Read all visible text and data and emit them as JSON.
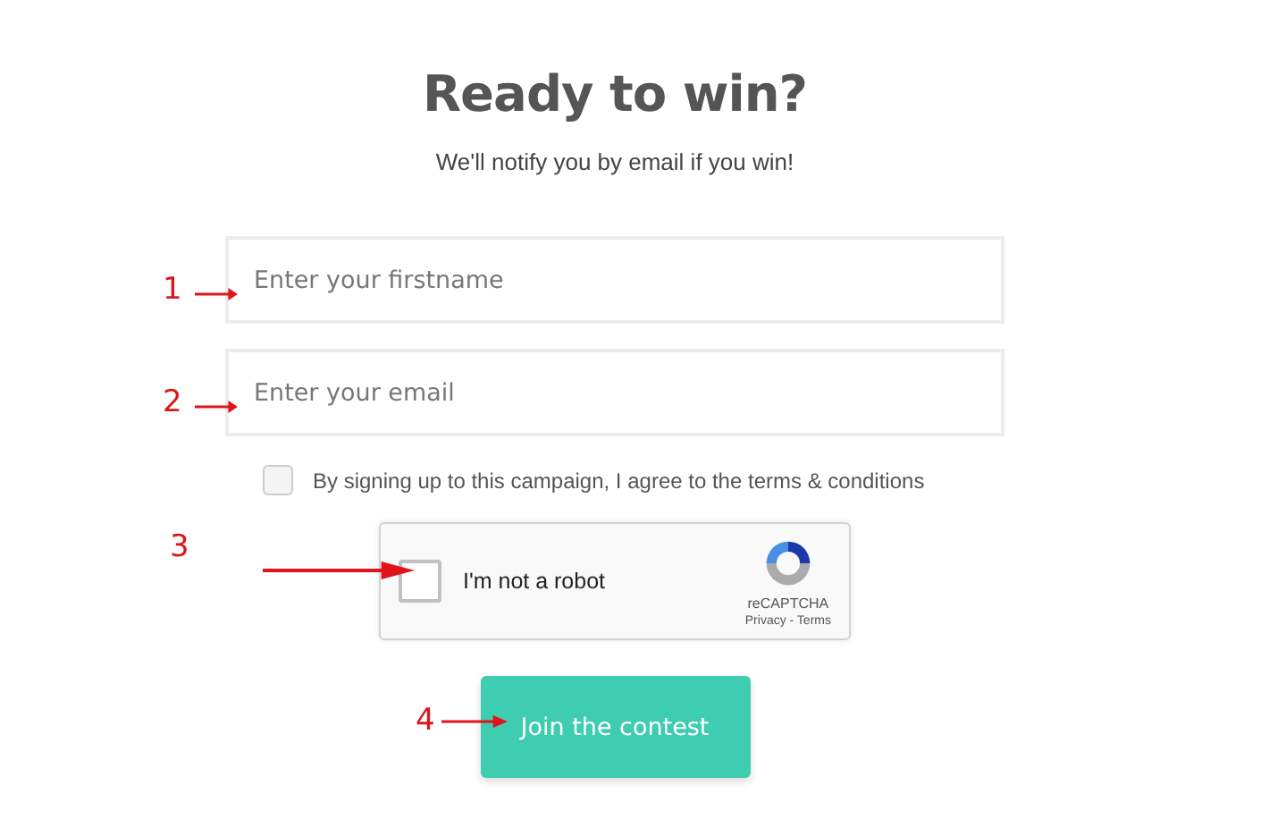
{
  "title": "Ready to win?",
  "subtitle": "We'll notify you by email if you win!",
  "fields": [
    {
      "placeholder": "Enter your firstname",
      "annotation": "1"
    },
    {
      "placeholder": "Enter your email",
      "annotation": "2"
    }
  ],
  "terms": {
    "label": "By signing up to this campaign, I agree to the terms & conditions",
    "checked": false
  },
  "captcha": {
    "label": "I'm not a robot",
    "checked": false,
    "brand": "reCAPTCHA",
    "links": "Privacy - Terms",
    "annotation": "3"
  },
  "submit": {
    "label": "Join the contest",
    "annotation": "4"
  }
}
